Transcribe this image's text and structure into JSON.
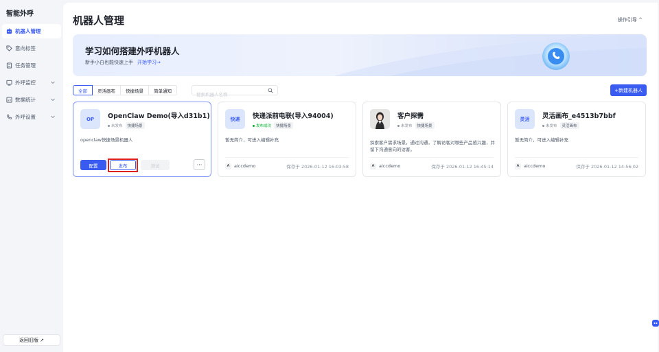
{
  "brand": "智能外呼",
  "sidebar": {
    "items": [
      {
        "label": "机器人管理",
        "icon": "robot-icon",
        "active": true
      },
      {
        "label": "意向标签",
        "icon": "tag-icon"
      },
      {
        "label": "任务管理",
        "icon": "task-icon"
      },
      {
        "label": "外呼监控",
        "icon": "monitor-icon",
        "expandable": true
      },
      {
        "label": "数据统计",
        "icon": "chart-icon",
        "expandable": true
      },
      {
        "label": "外呼设置",
        "icon": "phone-icon",
        "expandable": true
      }
    ],
    "back_label": "返回旧版 ↗"
  },
  "header": {
    "title": "机器人管理",
    "guide": "操作引导 ^"
  },
  "banner": {
    "title": "学习如何搭建外呼机器人",
    "subtitle": "新手小白也能快速上手",
    "link": "开始学习→"
  },
  "filters": [
    "全部",
    "灵活画布",
    "快捷场景",
    "简单通知"
  ],
  "search": {
    "placeholder": "搜索机器人名称"
  },
  "new_button": "+新建机器人",
  "cards": [
    {
      "avatar": "OP",
      "name": "OpenClaw Demo(导入d31b1)",
      "status": "未发布",
      "tag": "快捷场景",
      "desc": "openclaw快捷场景机器人",
      "buttons": {
        "config": "配置",
        "publish": "发布",
        "test": "测试",
        "more": "···"
      }
    },
    {
      "avatar": "快递",
      "name": "快递派前电联(导入94004)",
      "status": "发布成功",
      "tag": "快捷场景",
      "desc": "暂无简介，可进入编辑补充",
      "owner_badge": "A",
      "owner": "aiccdemo",
      "saved": "保存于 2026-01-12 16:03:58"
    },
    {
      "avatar": "",
      "name": "客户探需",
      "status": "未发布",
      "tag": "快捷场景",
      "desc": "探索客户需求场景，通过沟通，了解访客对哪些产品感兴趣，并留下沟通意向的访客。",
      "owner_badge": "A",
      "owner": "aiccdemo",
      "saved": "保存于 2026-01-12 16:45:14"
    },
    {
      "avatar": "灵活",
      "name": "灵活画布_e4513b7bbf",
      "status": "未发布",
      "tag": "灵活画布",
      "desc": "暂无简介，可进入编辑补充",
      "owner_badge": "A",
      "owner": "aiccdemo",
      "saved": "保存于 2026-01-12 14:56:02"
    }
  ],
  "colors": {
    "accent": "#3a5bf0",
    "success": "#00b42a",
    "highlight": "#e0201d"
  }
}
